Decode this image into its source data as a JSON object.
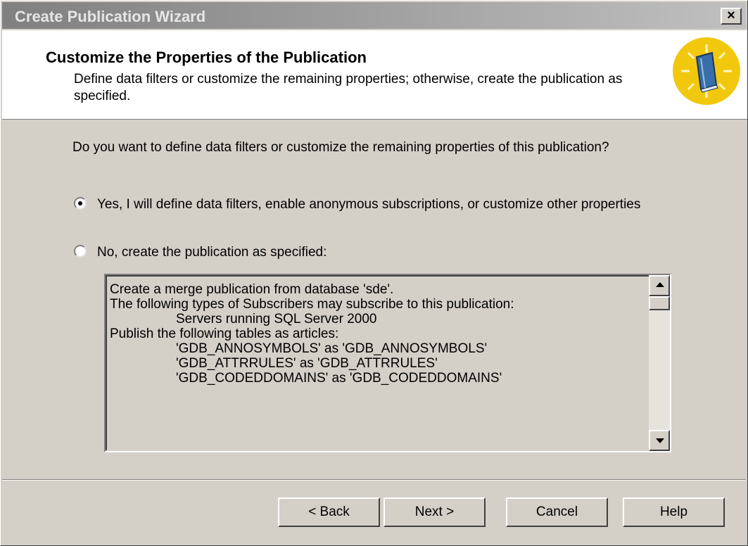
{
  "window": {
    "title": "Create Publication Wizard",
    "close_label": "×"
  },
  "header": {
    "title": "Customize the Properties of the Publication",
    "description": "Define data filters or customize the remaining properties; otherwise, create the publication as specified."
  },
  "question": "Do you want to define data filters or customize the remaining properties of this publication?",
  "options": [
    {
      "label": "Yes, I will define data filters, enable anonymous subscriptions, or customize other properties",
      "selected": true
    },
    {
      "label": "No, create the publication as specified:",
      "selected": false
    }
  ],
  "summary": {
    "lines": [
      "Create a merge publication from database 'sde'.",
      "",
      "The following types of Subscribers may subscribe to this publication:",
      "Servers running SQL Server 2000",
      "",
      "Publish the following tables as articles:",
      "'GDB_ANNOSYMBOLS' as 'GDB_ANNOSYMBOLS'",
      "'GDB_ATTRRULES' as 'GDB_ATTRRULES'",
      "'GDB_CODEDDOMAINS' as 'GDB_CODEDDOMAINS'"
    ]
  },
  "buttons": {
    "back": "< Back",
    "next": "Next >",
    "cancel": "Cancel",
    "help": "Help"
  },
  "icon": "publication-book-icon"
}
